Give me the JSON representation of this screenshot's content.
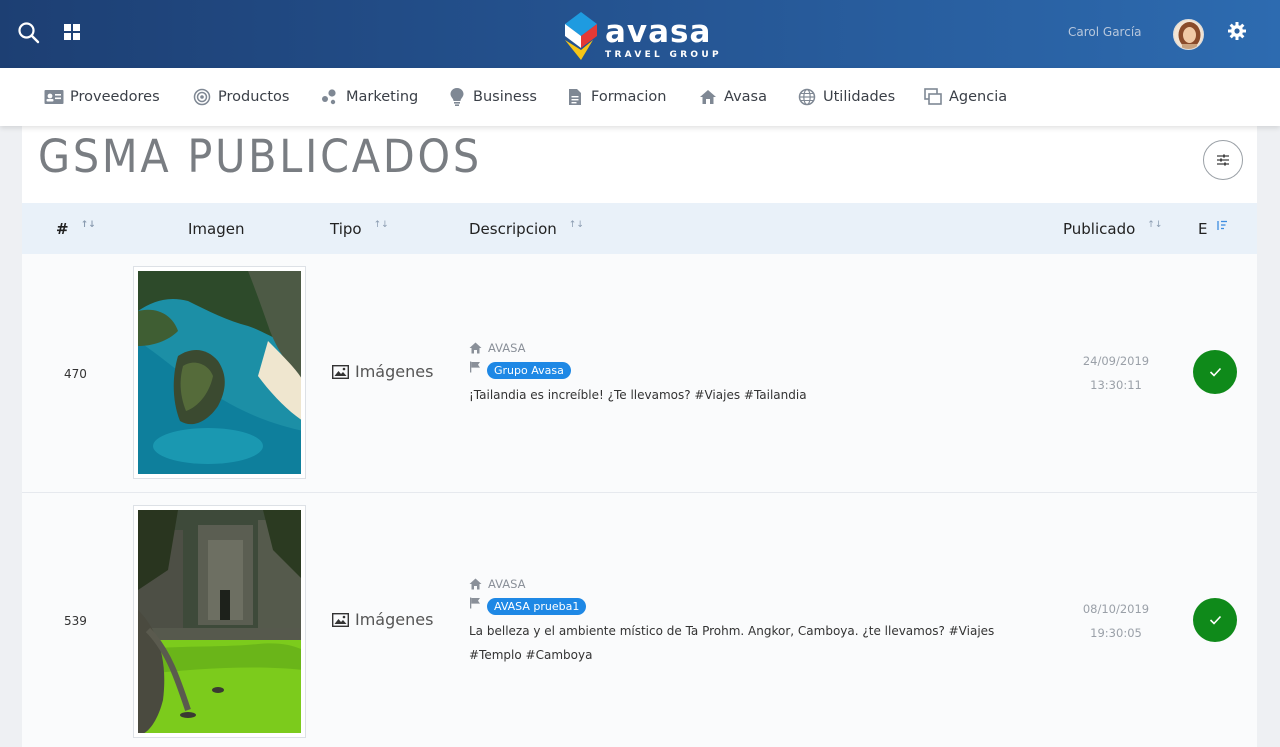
{
  "topbar": {
    "logo_word": "avasa",
    "logo_sub": "TRAVEL GROUP",
    "user_name": "Carol García",
    "icons": [
      "search-icon",
      "apps-icon",
      "gear-icon"
    ]
  },
  "nav": {
    "items": [
      {
        "label": "Proveedores",
        "icon": "id-card-icon"
      },
      {
        "label": "Productos",
        "icon": "target-icon"
      },
      {
        "label": "Marketing",
        "icon": "bubbles-icon"
      },
      {
        "label": "Business",
        "icon": "lightbulb-icon"
      },
      {
        "label": "Formacion",
        "icon": "document-icon"
      },
      {
        "label": "Avasa",
        "icon": "home-icon"
      },
      {
        "label": "Utilidades",
        "icon": "globe-icon"
      },
      {
        "label": "Agencia",
        "icon": "windows-icon"
      }
    ]
  },
  "page": {
    "title": "GSMA PUBLICADOS"
  },
  "table": {
    "headers": {
      "id": "#",
      "image": "Imagen",
      "type": "Tipo",
      "description": "Descripcion",
      "published": "Publicado",
      "status": "E"
    },
    "rows": [
      {
        "id": "470",
        "type": "Imágenes",
        "owner": "AVASA",
        "group": "Grupo Avasa",
        "text_line1": "¡Tailandia es increíble! ¿Te llevamos? #Viajes #Tailandia",
        "text_line2": "",
        "date": "24/09/2019",
        "time": "13:30:11"
      },
      {
        "id": "539",
        "type": "Imágenes",
        "owner": "AVASA",
        "group": "AVASA prueba1",
        "text_line1": "La belleza y el ambiente místico de Ta Prohm. Angkor, Camboya. ¿te llevamos? #Viajes",
        "text_line2": "#Templo #Camboya",
        "date": "08/10/2019",
        "time": "19:30:05"
      }
    ]
  },
  "colors": {
    "topbar_start": "#1d3f73",
    "topbar_end": "#2d6bb0",
    "badge": "#1e88e5",
    "status_ok": "#0f8a1a",
    "header_bg": "#e9f1f9"
  }
}
